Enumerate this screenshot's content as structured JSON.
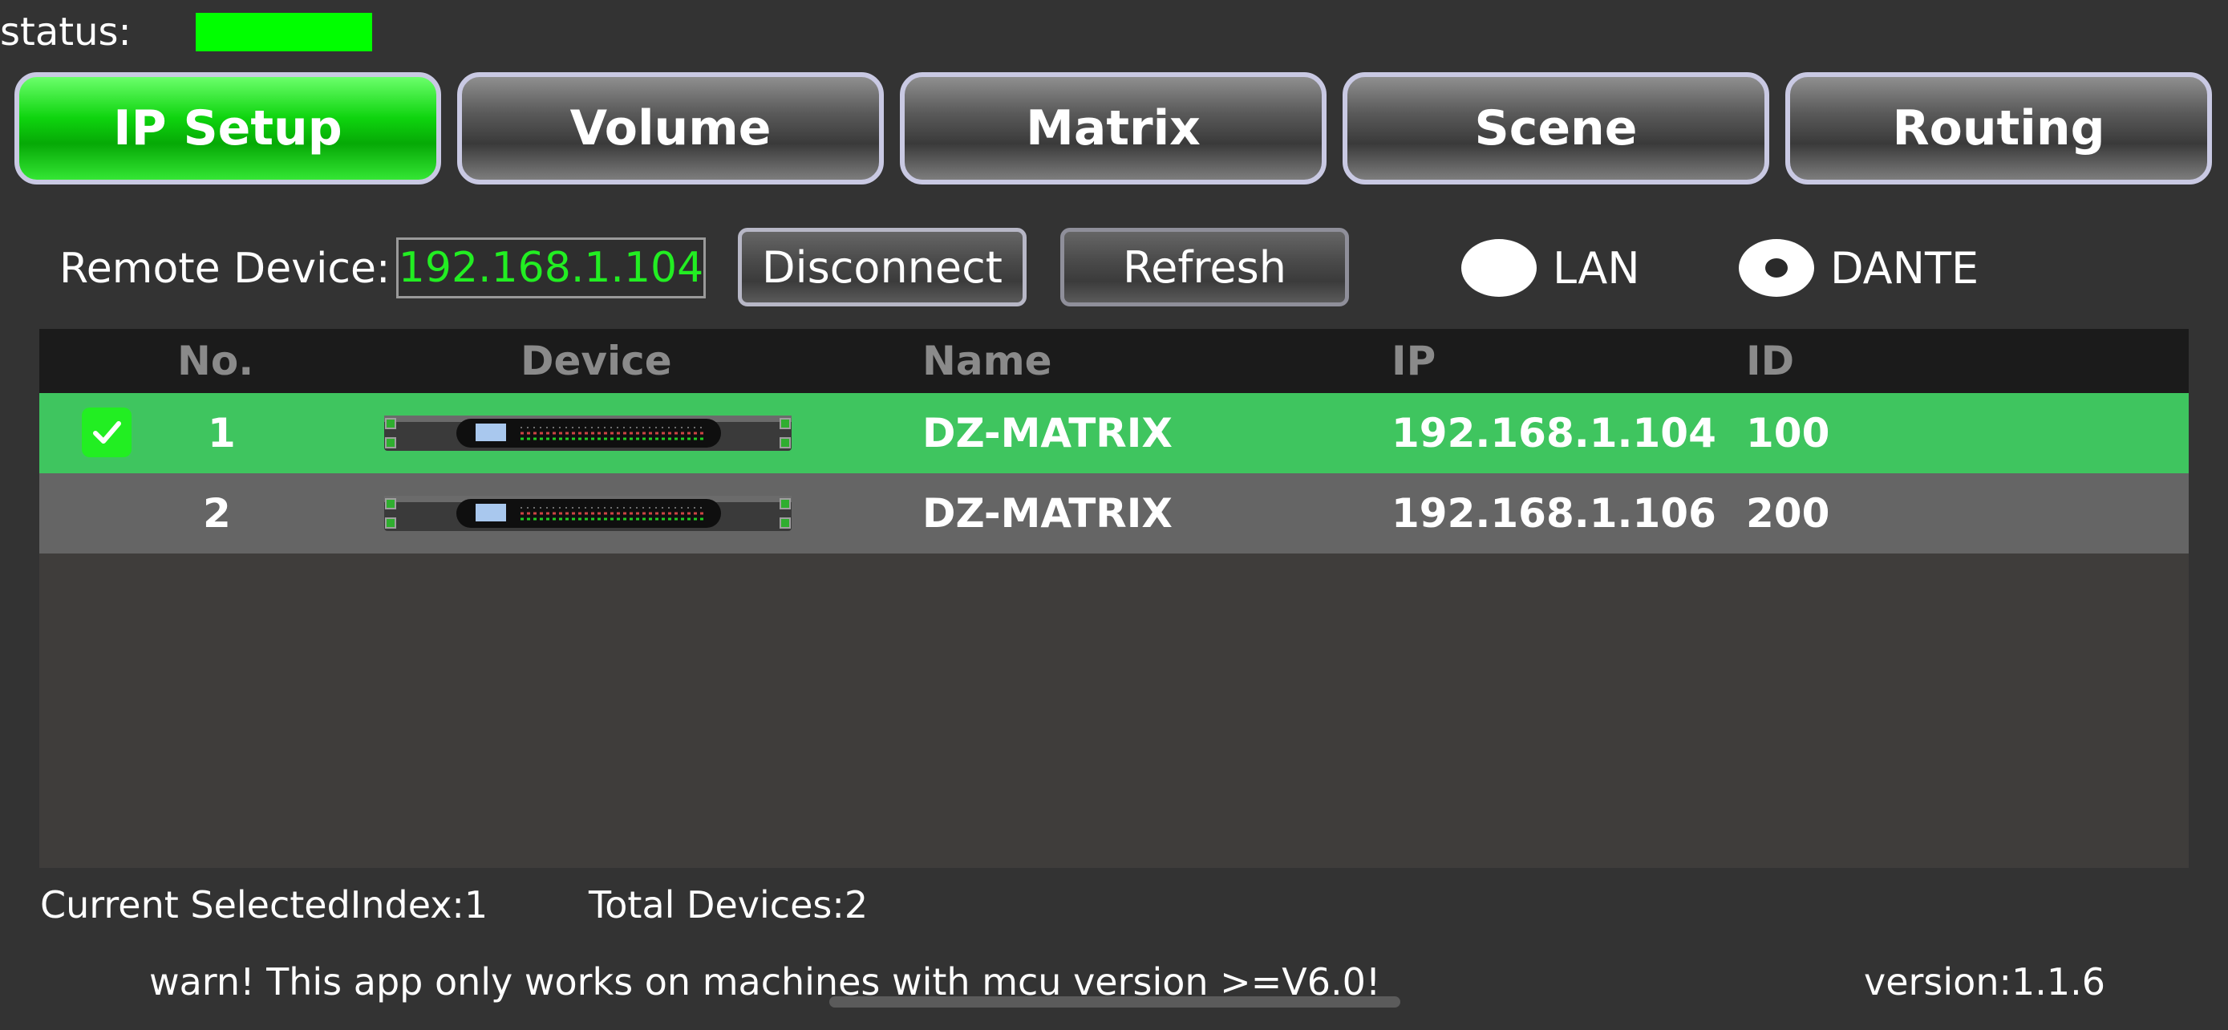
{
  "status": {
    "label": "status:",
    "indicator_color": "#00ff00"
  },
  "tabs": [
    {
      "label": "IP Setup",
      "active": true
    },
    {
      "label": "Volume",
      "active": false
    },
    {
      "label": "Matrix",
      "active": false
    },
    {
      "label": "Scene",
      "active": false
    },
    {
      "label": "Routing",
      "active": false
    }
  ],
  "remote": {
    "label": "Remote Device:",
    "ip": "192.168.1.104",
    "disconnect_label": "Disconnect",
    "refresh_label": "Refresh"
  },
  "network": {
    "options": [
      {
        "label": "LAN",
        "selected": false
      },
      {
        "label": "DANTE",
        "selected": true
      }
    ]
  },
  "table": {
    "headers": {
      "no": "No.",
      "device": "Device",
      "name": "Name",
      "ip": "IP",
      "id": "ID"
    },
    "rows": [
      {
        "no": "1",
        "name": "DZ-MATRIX",
        "ip": "192.168.1.104",
        "id": "100",
        "checked": true
      },
      {
        "no": "2",
        "name": "DZ-MATRIX",
        "ip": "192.168.1.106",
        "id": "200",
        "checked": false
      }
    ]
  },
  "footer": {
    "selected_index": "Current SelectedIndex:1",
    "total_devices": "Total Devices:2",
    "warning": "warn! This app only works on machines with mcu version >=V6.0!",
    "version": "version:1.1.6"
  },
  "colors": {
    "accent_green": "#00ff00",
    "selected_row": "#3fc55f",
    "background": "#333333"
  },
  "icons": {
    "checkbox": "checkmark-icon",
    "device": "rack-device-icon"
  }
}
